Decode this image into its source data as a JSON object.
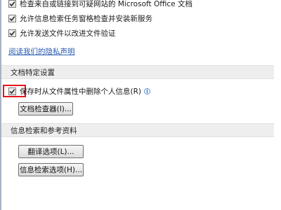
{
  "privacy_options": [
    {
      "label": "检查来自或链接到可疑网站的 Microsoft Office 文档",
      "checked": true
    },
    {
      "label": "允许信息检索任务窗格检查并安装新服务",
      "checked": true
    },
    {
      "label": "允许发送文件以改进文件验证",
      "checked": true
    }
  ],
  "privacy_link": "阅读我们的隐私声明",
  "document_specific": {
    "header": "文档特定设置",
    "remove_personal_info_label": "保存时从文件属性中删除个人信息(R)",
    "remove_personal_info_checked": true,
    "info_icon_glyph": "i",
    "info_icon_name": "info-icon",
    "inspector_button": "文档检查器(I)..."
  },
  "research": {
    "header": "信息检索和参考资料",
    "translation_button": "翻译选项(L)...",
    "research_button": "信息检索选项(H)..."
  },
  "colors": {
    "highlight": "#e8141b",
    "link": "#2a5db0",
    "section_bg": "#eeeeee"
  }
}
